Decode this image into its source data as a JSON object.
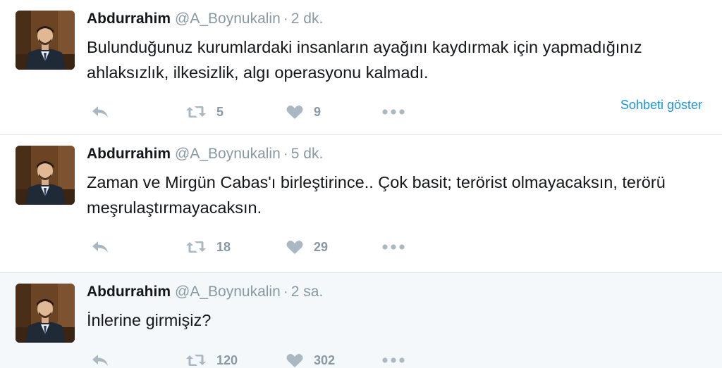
{
  "tweets": [
    {
      "author_name": "Abdurrahim",
      "author_handle": "@A_Boynukalin",
      "separator": "·",
      "time": "2 dk.",
      "text": "Bulunduğunuz kurumlardaki insanların ayağını kaydırmak için yapmadığınız ahlaksızlık, ilkesizlik, algı operasyonu kalmadı.",
      "retweets": "5",
      "likes": "9",
      "show_conversation": "Sohbeti göster"
    },
    {
      "author_name": "Abdurrahim",
      "author_handle": "@A_Boynukalin",
      "separator": "·",
      "time": "5 dk.",
      "text": "Zaman ve Mirgün Cabas'ı birleştirince.. Çok basit; terörist olmayacaksın, terörü meşrulaştırmayacaksın.",
      "retweets": "18",
      "likes": "29"
    },
    {
      "author_name": "Abdurrahim",
      "author_handle": "@A_Boynukalin",
      "separator": "·",
      "time": "2 sa.",
      "text": "İnlerine girmişiz?",
      "retweets": "120",
      "likes": "302"
    }
  ],
  "icons": {
    "reply": "reply-icon",
    "retweet": "retweet-icon",
    "like": "heart-icon",
    "more": "more-dots-icon"
  },
  "colors": {
    "text": "#14171a",
    "muted": "#8899a6",
    "icon": "#aab8c2",
    "link": "#1b95e0",
    "highlight_bg": "#f5f8fa",
    "divider": "#e1e8ed"
  }
}
